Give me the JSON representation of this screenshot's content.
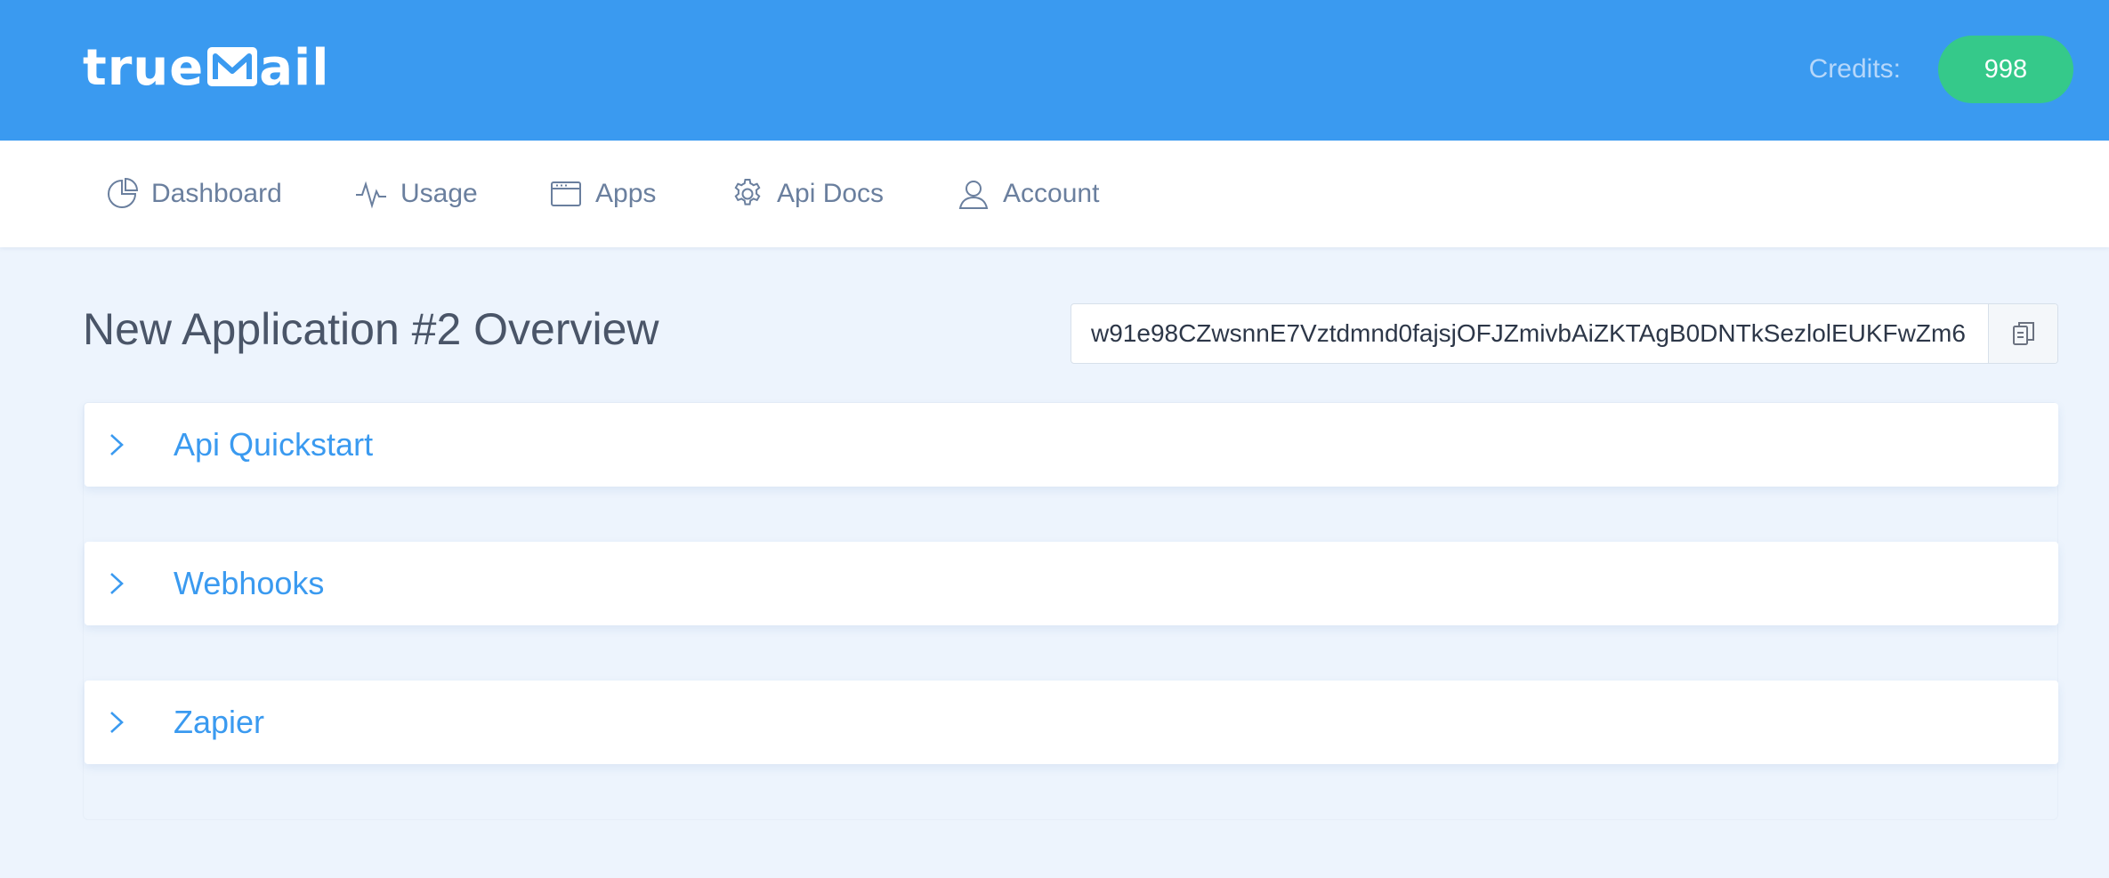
{
  "header": {
    "logo": {
      "text_before": "true",
      "text_after": "ail",
      "glyph_icon": "envelope-m-icon"
    },
    "credits_label": "Credits:",
    "credits_value": "998",
    "colors": {
      "header_bg": "#3a9af0",
      "credits_badge": "#35c98a"
    }
  },
  "nav": {
    "items": [
      {
        "label": "Dashboard",
        "icon": "pie-chart-icon"
      },
      {
        "label": "Usage",
        "icon": "activity-icon"
      },
      {
        "label": "Apps",
        "icon": "browser-window-icon"
      },
      {
        "label": "Api Docs",
        "icon": "gear-icon"
      },
      {
        "label": "Account",
        "icon": "user-icon"
      }
    ]
  },
  "main": {
    "title": "New Application #2 Overview",
    "api_key": "w91e98CZwsnnE7Vztdmnd0fajsjOFJZmivbAiZKTAgB0DNTkSezlolEUKFwZm6",
    "copy_icon": "clipboard-icon",
    "sections": [
      {
        "label": "Api Quickstart",
        "icon": "chevron-right-icon"
      },
      {
        "label": "Webhooks",
        "icon": "chevron-right-icon"
      },
      {
        "label": "Zapier",
        "icon": "chevron-right-icon"
      }
    ],
    "colors": {
      "accent": "#3a9af0",
      "page_bg": "#edf4fd"
    }
  }
}
